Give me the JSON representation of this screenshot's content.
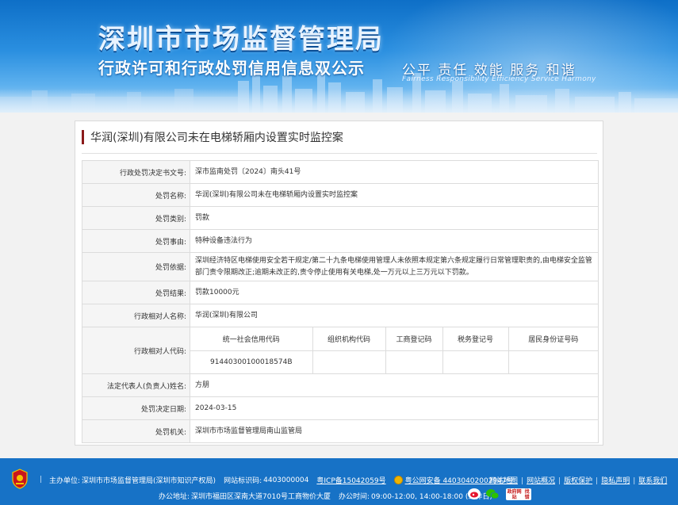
{
  "header": {
    "title": "深圳市市场监督管理局",
    "subtitle": "行政许可和行政处罚信用信息双公示",
    "slogan": "公平  责任  效能  服务  和谐",
    "slogan_en": "Fairness  Responsibility  Efficiency  Service  Harmony"
  },
  "case": {
    "title": "华润(深圳)有限公司未在电梯轿厢内设置实时监控案",
    "rows": [
      {
        "label": "行政处罚决定书文号:",
        "value": "深市监南处罚〔2024〕南头41号"
      },
      {
        "label": "处罚名称:",
        "value": "华润(深圳)有限公司未在电梯轿厢内设置实时监控案"
      },
      {
        "label": "处罚类别:",
        "value": "罚款"
      },
      {
        "label": "处罚事由:",
        "value": "特种设备违法行为"
      },
      {
        "label": "处罚依据:",
        "value": "深圳经济特区电梯使用安全若干规定/第二十九条电梯使用管理人未依照本规定第六条规定履行日常管理职责的,由电梯安全监管部门责令限期改正;逾期未改正的,责令停止使用有关电梯,处一万元以上三万元以下罚款。"
      },
      {
        "label": "处罚结果:",
        "value": "罚款10000元"
      },
      {
        "label": "行政相对人名称:",
        "value": "华润(深圳)有限公司"
      }
    ],
    "code_label": "行政相对人代码:",
    "code_headers": [
      "统一社会信用代码",
      "组织机构代码",
      "工商登记码",
      "税务登记号",
      "居民身份证号码"
    ],
    "code_values": [
      "91440300100018574B",
      "",
      "",
      "",
      ""
    ],
    "rows2": [
      {
        "label": "法定代表人(负责人)姓名:",
        "value": "方朋"
      },
      {
        "label": "处罚决定日期:",
        "value": "2024-03-15"
      },
      {
        "label": "处罚机关:",
        "value": "深圳市市场监督管理局南山监管局"
      }
    ]
  },
  "footer": {
    "sep": "|",
    "sponsor_label": "主办单位:",
    "sponsor": "深圳市市场监督管理局(深圳市知识产权局)",
    "site_id_label": "网站标识码:",
    "site_id": "4403000004",
    "icp": "粤ICP备15042059号",
    "police": "粤公网安备 44030402002947号",
    "links": [
      "网站地图",
      "网站概况",
      "版权保护",
      "隐私声明",
      "联系我们"
    ],
    "address_label": "办公地址:",
    "address": "深圳市福田区深南大道7010号工商物价大厦",
    "hours_label": "办公时间:",
    "hours": "09:00-12:00, 14:00-18:00 (工作日)",
    "gov_badge_l1": "政府网站",
    "gov_badge_l2": "找错"
  },
  "colors": {
    "header_blue": "#1772c6",
    "title_bar": "#8b1a1a",
    "label_bg": "#f5f5f5"
  }
}
